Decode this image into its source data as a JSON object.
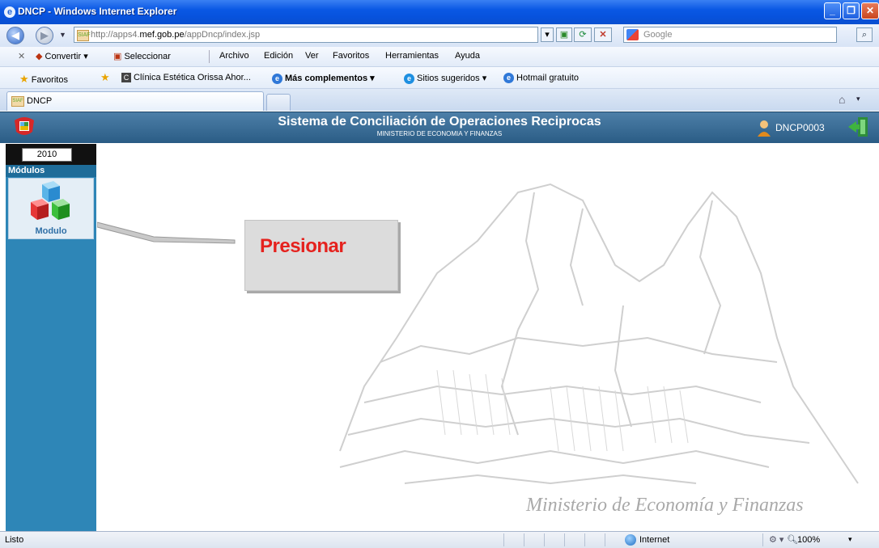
{
  "window": {
    "title": "DNCP - Windows Internet Explorer"
  },
  "address_bar": {
    "url_prefix": "http://apps4.",
    "url_domain": "mef.gob.pe",
    "url_path": "/appDncp/index.jsp",
    "search_placeholder": "Google"
  },
  "command_bar": {
    "convert_label": "Convertir",
    "select_label": "Seleccionar",
    "menus": [
      "Archivo",
      "Edición",
      "Ver",
      "Favoritos",
      "Herramientas",
      "Ayuda"
    ]
  },
  "favorites_bar": {
    "favorites_label": "Favoritos",
    "items": [
      "Clínica Estética Orissa Ahor...",
      "Más complementos",
      "Sitios sugeridos",
      "Hotmail gratuito"
    ]
  },
  "tabs": [
    {
      "label": "DNCP"
    }
  ],
  "app": {
    "title": "Sistema de Conciliación de Operaciones Reciprocas",
    "subtitle": "MINISTERIO DE ECONOMIA Y FINANZAS",
    "user": "DNCP0003",
    "year": "2010",
    "modules_header": "Módulos",
    "module_label": "Modulo",
    "callout_text": "Presionar",
    "watermark": "Ministerio de Economía y Finanzas"
  },
  "status_bar": {
    "status": "Listo",
    "zone": "Internet",
    "zoom": "100%"
  },
  "colors": {
    "titlebar": "#0a58e4",
    "app_header": "#3a6d96",
    "sidebar": "#2e86b7",
    "callout_text": "#e5221e"
  }
}
